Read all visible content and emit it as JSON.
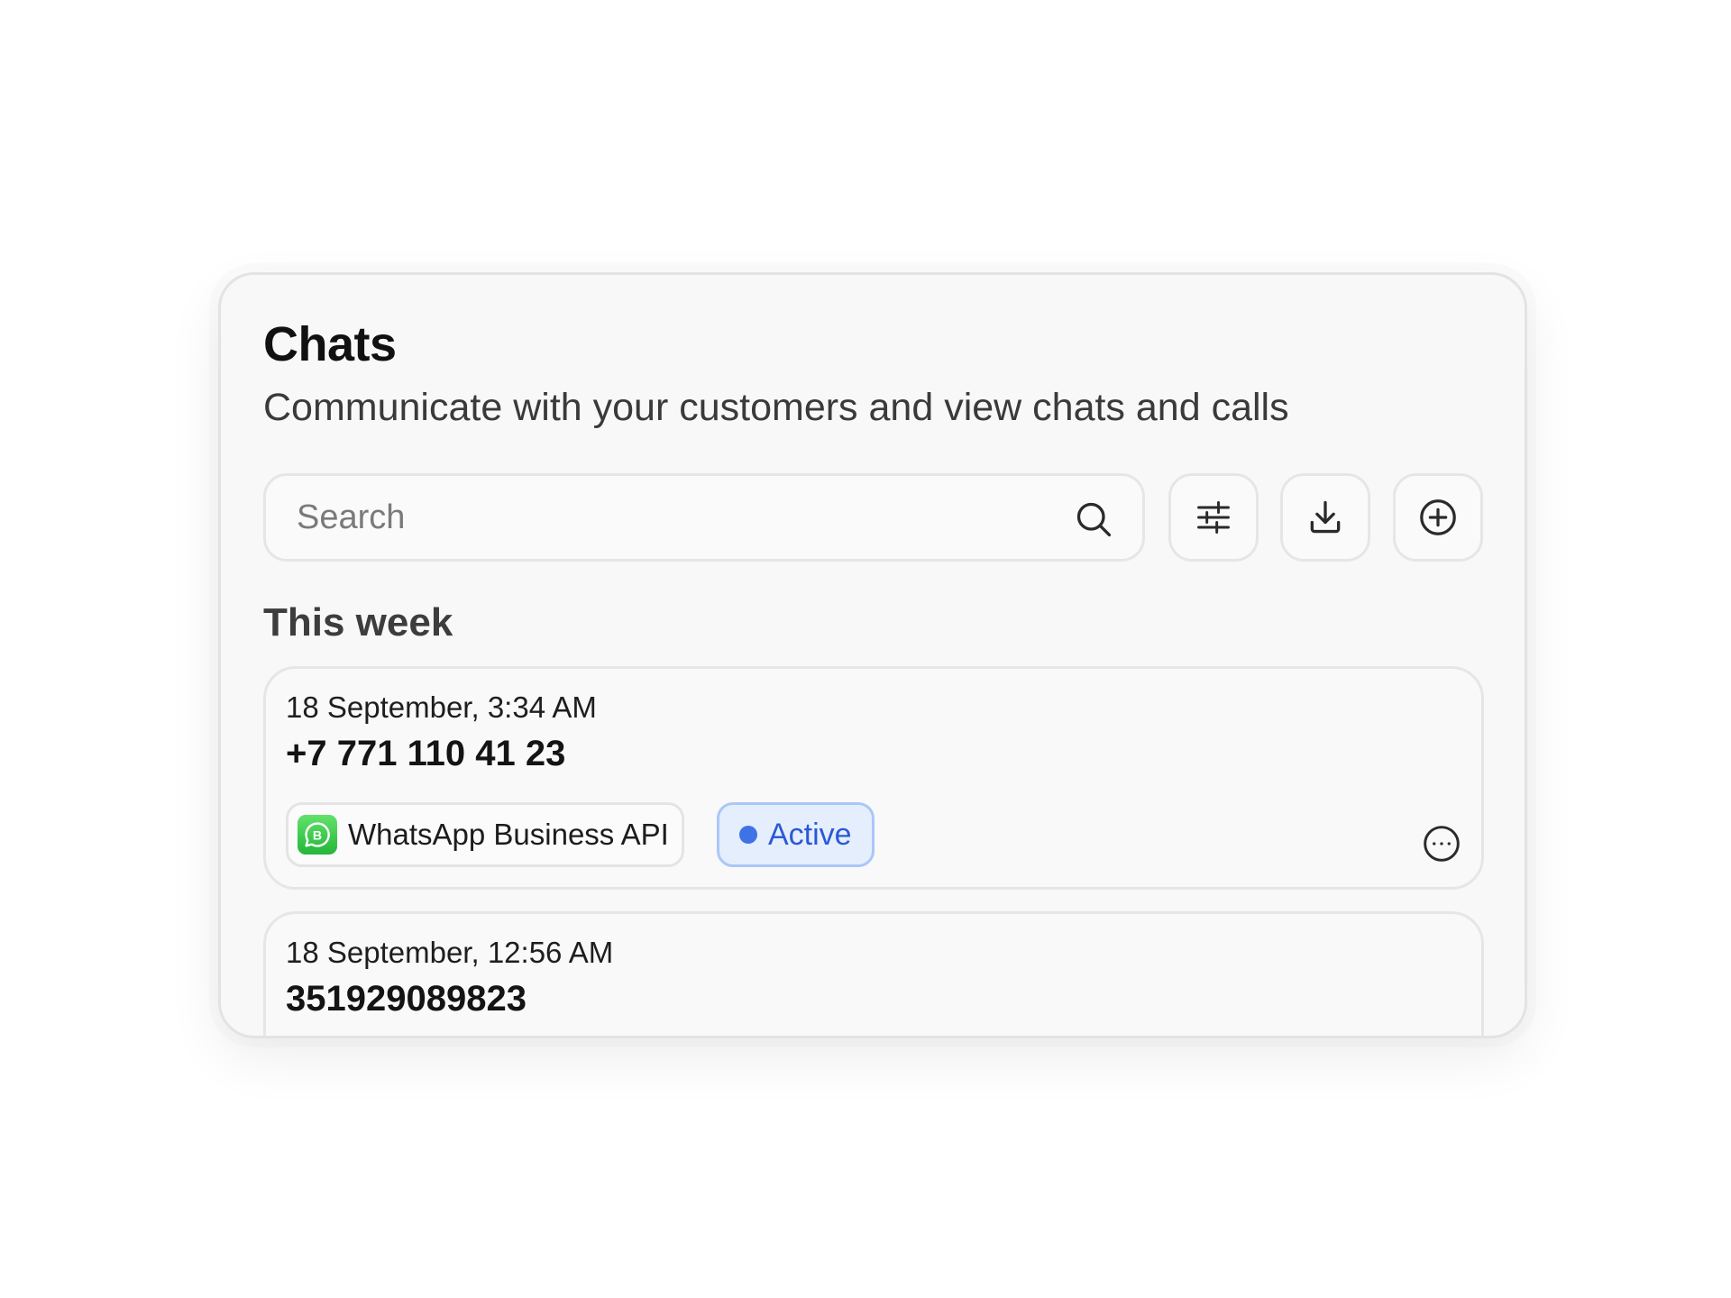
{
  "header": {
    "title": "Chats",
    "subtitle": "Communicate with your customers and view chats and calls"
  },
  "toolbar": {
    "search_placeholder": "Search",
    "search_value": "",
    "search_icon": "search-icon",
    "filter_icon": "sliders-icon",
    "download_icon": "download-icon",
    "add_icon": "plus-circle-icon"
  },
  "sections": [
    {
      "label": "This week",
      "chats": [
        {
          "date": "18 September, 3:34 AM",
          "contact": "+7 771 110 41 23",
          "channel": "WhatsApp Business API",
          "channel_icon": "whatsapp-business-icon",
          "status": "Active",
          "status_color": "#3f72e6",
          "more_icon": "more-horizontal-icon"
        },
        {
          "date": "18 September, 12:56 AM",
          "contact": "351929089823"
        }
      ]
    }
  ],
  "colors": {
    "card_background": "#f8f8f8",
    "border": "#e6e6e6",
    "active_badge_bg": "#e5eefc",
    "active_badge_text": "#2a59d6",
    "whatsapp_green": "#2fc244"
  }
}
